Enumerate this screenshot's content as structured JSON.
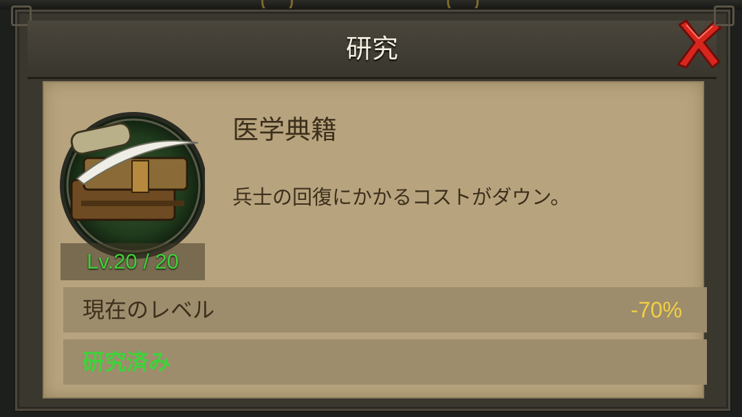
{
  "dialog": {
    "title": "研究",
    "close_icon": "close-x-icon"
  },
  "research": {
    "icon": "medical-book-icon",
    "level": "Lv.20 / 20",
    "name": "医学典籍",
    "description": "兵士の回復にかかるコストがダウン。"
  },
  "stats": {
    "current_level_label": "現在のレベル",
    "current_level_value": "-70%",
    "status": "研究済み"
  },
  "colors": {
    "panel": "#b7a47e",
    "row": "#9d8d6c",
    "value_yellow": "#f2cf44",
    "status_green": "#3fd23a",
    "close_red": "#d7261e"
  }
}
